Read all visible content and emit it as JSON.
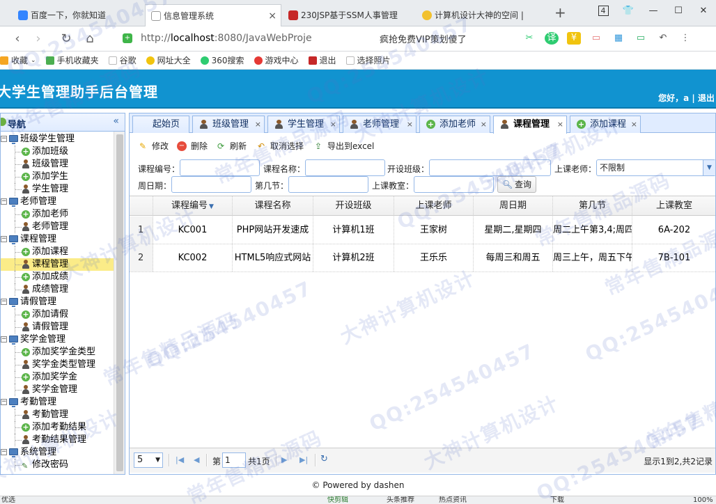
{
  "browser": {
    "tabs": [
      {
        "title": "百度一下，你就知道",
        "icon": "baidu-icon",
        "color": "#3385ff"
      },
      {
        "title": "信息管理系统",
        "icon": "page-icon",
        "color": "#ffffff",
        "close": "×"
      },
      {
        "title": "230JSP基于SSM人事管理",
        "icon": "red-square-icon",
        "color": "#c62828"
      },
      {
        "title": "计算机设计大神的空间 |",
        "icon": "star-icon",
        "color": "#f2c12e"
      }
    ],
    "new_tab": "+",
    "tab_count": "4",
    "url_prefix": "http://",
    "url_host": "localhost",
    "url_rest": ":8080/JavaWebProje",
    "promo_text": "疯抢免费VIP策划傻了",
    "bookmarks": [
      {
        "label": "收藏",
        "color": "#f5a623"
      },
      {
        "label": "手机收藏夹",
        "color": "#4caf50"
      },
      {
        "label": "谷歌",
        "color": "#bdbdbd"
      },
      {
        "label": "网址大全",
        "color": "#f1c40f"
      },
      {
        "label": "360搜索",
        "color": "#2ecc71"
      },
      {
        "label": "游戏中心",
        "color": "#e53935"
      },
      {
        "label": "退出",
        "color": "#c62828"
      },
      {
        "label": "选择照片",
        "color": "#bdbdbd"
      }
    ]
  },
  "app": {
    "title": "大学生管理助手后台管理",
    "user_text": "您好，a | 退出",
    "nav_title": "导航",
    "collapse_icon": "«"
  },
  "tree": [
    {
      "type": "group",
      "label": "班级学生管理"
    },
    {
      "type": "leaf",
      "icon": "add",
      "label": "添加班级"
    },
    {
      "type": "leaf",
      "icon": "user",
      "label": "班级管理"
    },
    {
      "type": "leaf",
      "icon": "add",
      "label": "添加学生"
    },
    {
      "type": "leaf",
      "icon": "user",
      "label": "学生管理"
    },
    {
      "type": "group",
      "label": "老师管理"
    },
    {
      "type": "leaf",
      "icon": "add",
      "label": "添加老师"
    },
    {
      "type": "leaf",
      "icon": "user",
      "label": "老师管理"
    },
    {
      "type": "group",
      "label": "课程管理"
    },
    {
      "type": "leaf",
      "icon": "add",
      "label": "添加课程"
    },
    {
      "type": "leaf",
      "icon": "user",
      "label": "课程管理",
      "selected": true
    },
    {
      "type": "leaf",
      "icon": "add",
      "label": "添加成绩"
    },
    {
      "type": "leaf",
      "icon": "user",
      "label": "成绩管理"
    },
    {
      "type": "group",
      "label": "请假管理"
    },
    {
      "type": "leaf",
      "icon": "add",
      "label": "添加请假"
    },
    {
      "type": "leaf",
      "icon": "user",
      "label": "请假管理"
    },
    {
      "type": "group",
      "label": "奖学金管理"
    },
    {
      "type": "leaf",
      "icon": "add",
      "label": "添加奖学金类型"
    },
    {
      "type": "leaf",
      "icon": "user",
      "label": "奖学金类型管理"
    },
    {
      "type": "leaf",
      "icon": "add",
      "label": "添加奖学金"
    },
    {
      "type": "leaf",
      "icon": "user",
      "label": "奖学金管理"
    },
    {
      "type": "group",
      "label": "考勤管理"
    },
    {
      "type": "leaf",
      "icon": "user",
      "label": "考勤管理"
    },
    {
      "type": "leaf",
      "icon": "add",
      "label": "添加考勤结果"
    },
    {
      "type": "leaf",
      "icon": "user",
      "label": "考勤结果管理"
    },
    {
      "type": "group",
      "label": "系统管理"
    },
    {
      "type": "leaf",
      "icon": "edit",
      "label": "修改密码"
    }
  ],
  "page_tabs": [
    {
      "label": "起始页",
      "icon": "none",
      "closable": false
    },
    {
      "label": "班级管理",
      "icon": "user",
      "closable": true
    },
    {
      "label": "学生管理",
      "icon": "user",
      "closable": true
    },
    {
      "label": "老师管理",
      "icon": "user",
      "closable": true
    },
    {
      "label": "添加老师",
      "icon": "add",
      "closable": true
    },
    {
      "label": "课程管理",
      "icon": "user",
      "closable": true,
      "active": true
    },
    {
      "label": "添加课程",
      "icon": "add",
      "closable": true
    }
  ],
  "toolbar": {
    "edit": "修改",
    "delete": "删除",
    "refresh": "刷新",
    "cancel_select": "取消选择",
    "export": "导出到excel"
  },
  "search": {
    "course_no_label": "课程编号：",
    "course_no_value": "",
    "course_name_label": "课程名称：",
    "course_name_value": "",
    "class_label": "开设班级：",
    "class_value": "",
    "teacher_label": "上课老师：",
    "teacher_value": "不限制",
    "weekday_label": "周日期：",
    "weekday_value": "",
    "period_label": "第几节：",
    "period_value": "",
    "room_label": "上课教室：",
    "room_value": "",
    "query_button": "查询"
  },
  "grid": {
    "columns": [
      "课程编号",
      "课程名称",
      "开设班级",
      "上课老师",
      "周日期",
      "第几节",
      "上课教室"
    ],
    "rows": [
      {
        "rn": "1",
        "cells": [
          "KC001",
          "PHP网站开发速成",
          "计算机1班",
          "王家树",
          "星期二,星期四",
          "周二上午第3,4;周四",
          "6A-202"
        ]
      },
      {
        "rn": "2",
        "cells": [
          "KC002",
          "HTML5响应式网站",
          "计算机2班",
          "王乐乐",
          "每周三和周五",
          "周三上午，周五下午",
          "7B-101"
        ]
      }
    ]
  },
  "pager": {
    "page_size": "5",
    "page_prefix": "第",
    "page_value": "1",
    "page_suffix": "共1页",
    "info": "显示1到2,共2记录"
  },
  "footer": "© Powered by dashen",
  "status": {
    "left": "优选",
    "items": [
      "快剪辑",
      "头条推荐",
      "热点资讯",
      "下载",
      "100%"
    ]
  },
  "watermarks": [
    "QQ:254540457",
    "常年售精品源码",
    "大神计算机设计"
  ],
  "colors": {
    "header_blue": "#1193d0",
    "panel_border": "#95b8e7",
    "selected_row": "#fbec88"
  }
}
